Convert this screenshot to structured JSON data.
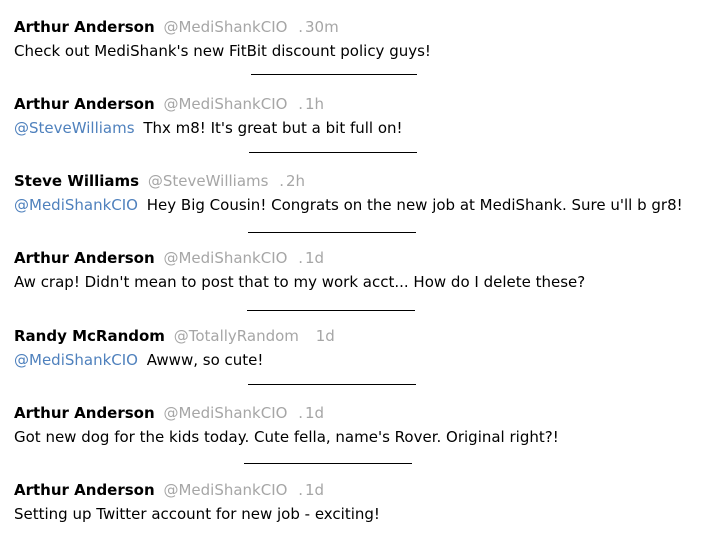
{
  "tweets": [
    {
      "name": "Arthur Anderson",
      "handle": "@MediShankCIO",
      "sep": ".",
      "time": "30m",
      "mention": "",
      "text": "Check out MediShank's  new FitBit discount policy guys!"
    },
    {
      "name": "Arthur Anderson",
      "handle": "@MediShankCIO",
      "sep": ".",
      "time": "1h",
      "mention": "@SteveWilliams",
      "text": "Thx m8! It's great but a bit full on!"
    },
    {
      "name": "Steve Williams",
      "handle": "@SteveWilliams",
      "sep": ".",
      "time": "2h",
      "mention": "@MediShankCIO",
      "text": "Hey Big Cousin! Congrats on the new job at MediShank.  Sure u'll b gr8!"
    },
    {
      "name": "Arthur Anderson",
      "handle": "@MediShankCIO",
      "sep": ".",
      "time": "1d",
      "mention": "",
      "text": "Aw crap! Didn't mean to post that to my work acct... How do I delete these?"
    },
    {
      "name": "Randy McRandom",
      "handle": "@TotallyRandom",
      "sep": "",
      "time": "1d",
      "mention": "@MediShankCIO",
      "text": "Awww, so cute!"
    },
    {
      "name": "Arthur Anderson",
      "handle": "@MediShankCIO",
      "sep": ".",
      "time": "1d",
      "mention": "",
      "text": "Got new dog for the kids today. Cute fella, name's Rover. Original right?!"
    },
    {
      "name": "Arthur Anderson",
      "handle": "@MediShankCIO",
      "sep": ".",
      "time": "1d",
      "mention": "",
      "text": "Setting up Twitter account for new job - exciting!"
    }
  ]
}
